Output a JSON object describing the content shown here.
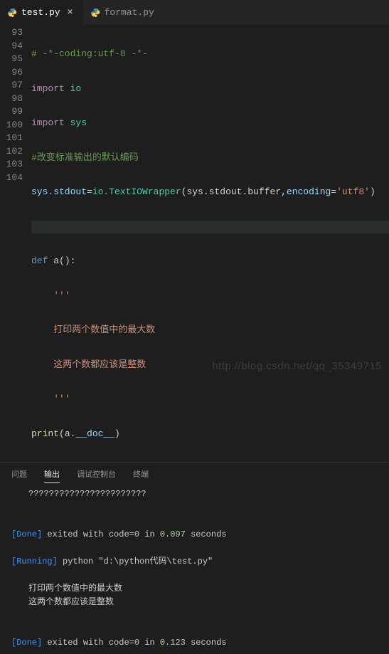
{
  "tabs": [
    {
      "label": "test.py",
      "active": true
    },
    {
      "label": "format.py",
      "active": false
    }
  ],
  "gutter": [
    "93",
    "94",
    "95",
    "96",
    "97",
    "98",
    "99",
    "100",
    "101",
    "102",
    "103",
    "104"
  ],
  "code": {
    "l93_comment": "# -*-coding:utf-8 -*-",
    "l94_kw": "import",
    "l94_mod": "io",
    "l95_kw": "import",
    "l95_mod": "sys",
    "l96_comment": "#改变标准输出的默认编码",
    "l97_a": "sys.stdout",
    "l97_b": "=",
    "l97_c": "io.TextIOWrapper",
    "l97_d": "(sys.stdout.buffer,",
    "l97_e": "encoding",
    "l97_f": "=",
    "l97_g": "'utf8'",
    "l97_h": ")",
    "l99_def": "def",
    "l99_name": "a",
    "l99_paren": "():",
    "l100_str": "'''",
    "l101_str": "打印两个数值中的最大数",
    "l102_str": "这两个数都应该是整数",
    "l103_str": "'''",
    "l104_print": "print",
    "l104_p1": "(a.",
    "l104_doc": "__doc__",
    "l104_p2": ")"
  },
  "panel": {
    "tabs": [
      "问题",
      "输出",
      "调试控制台",
      "终端"
    ],
    "active": 1
  },
  "output": {
    "qmarks": "???????????????????????",
    "done1_tag": "[Done]",
    "done1_a": "exited with code=",
    "done1_code": "0",
    "done1_b": " in ",
    "done1_time": "0.097",
    "done1_c": " seconds",
    "running_tag": "[Running]",
    "running_txt": " python \"d:\\python代码\\test.py\"",
    "line1": "打印两个数值中的最大数",
    "line2": "这两个数都应该是整数",
    "done2_tag": "[Done]",
    "done2_a": "exited with code=",
    "done2_code": "0",
    "done2_b": " in ",
    "done2_time": "0.123",
    "done2_c": " seconds"
  },
  "watermark": "http://blog.csdn.net/qq_35349715"
}
